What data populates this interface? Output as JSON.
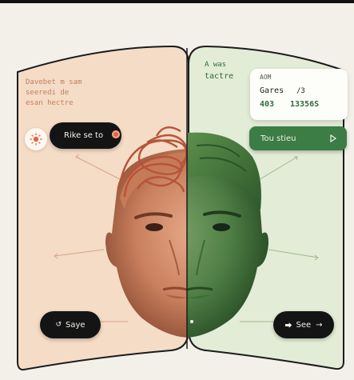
{
  "left_panel": {
    "lines": [
      "Davebet m sam",
      "seeredi de",
      "esan hectre"
    ],
    "pill_label": "Rike se to",
    "bottom_pill_label": "Saye",
    "bottom_pill_icon": "rotate-icon"
  },
  "right_panel": {
    "lines": [
      "A was",
      "tactre"
    ],
    "card": {
      "row1": "AOM",
      "row2_left": "Gares",
      "row2_right": "/3",
      "row3_left": "403",
      "row3_right": "13356S"
    },
    "green_pill_label": "Tou stieu",
    "bottom_pill_label": "See",
    "bottom_pill_icon": "arrow-right-icon"
  },
  "colors": {
    "left_panel_bg": "#f4dcc6",
    "right_panel_bg": "#e3ecd6",
    "accent_orange": "#e2663f",
    "accent_green": "#3c7c45"
  }
}
